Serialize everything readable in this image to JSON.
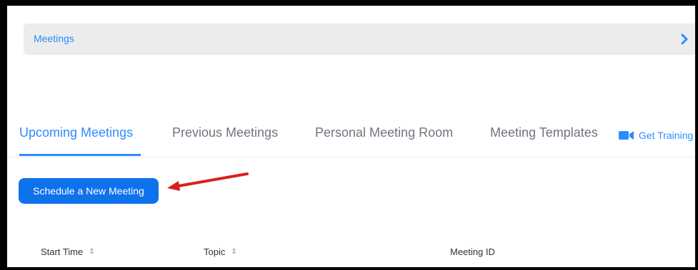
{
  "breadcrumb": {
    "label": "Meetings",
    "chevron_icon": "chevron-right-icon"
  },
  "tabs": [
    {
      "label": "Upcoming Meetings",
      "active": true
    },
    {
      "label": "Previous Meetings",
      "active": false
    },
    {
      "label": "Personal Meeting Room",
      "active": false
    },
    {
      "label": "Meeting Templates",
      "active": false
    }
  ],
  "training": {
    "label": "Get Training",
    "icon": "video-camera-icon"
  },
  "schedule_button": {
    "label": "Schedule a New Meeting"
  },
  "table": {
    "columns": [
      {
        "label": "Start Time",
        "sort_icon": "sort-icon"
      },
      {
        "label": "Topic",
        "sort_icon": "sort-icon"
      },
      {
        "label": "Meeting ID"
      }
    ]
  },
  "colors": {
    "accent": "#2d8cff",
    "button": "#0e72ed",
    "annotation_arrow": "#d8201d"
  }
}
